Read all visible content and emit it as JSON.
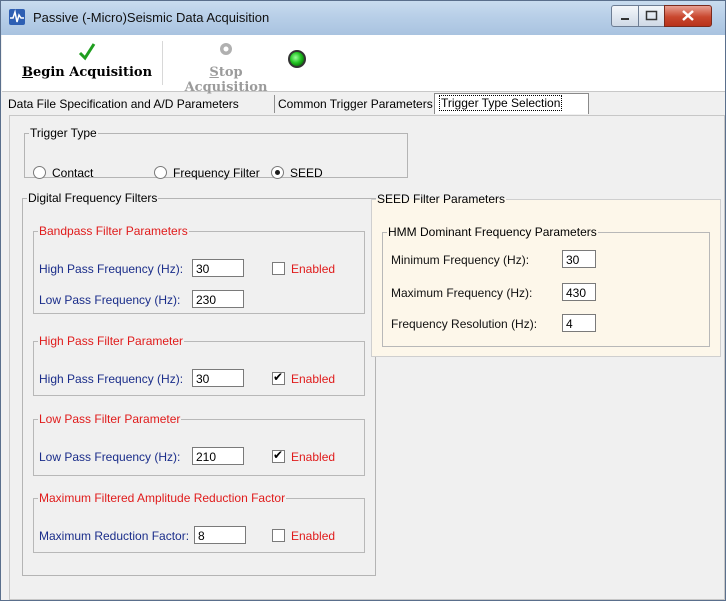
{
  "window": {
    "title": "Passive (-Micro)Seismic Data Acquisition",
    "controls": {
      "minimize": "minimize",
      "maximize": "maximize",
      "close": "close"
    }
  },
  "toolbar": {
    "begin_label": "Begin Acquisition",
    "stop_label": "Stop Acquisition",
    "begin_icon": "checkmark-icon",
    "stop_icon": "stop-gear-icon",
    "status_icon": "status-led-icon",
    "status_color": "#22c322"
  },
  "tabs": [
    {
      "label": "Data File Specification and A/D Parameters"
    },
    {
      "label": "Common Trigger Parameters"
    },
    {
      "label": "Trigger Type Selection",
      "selected": true
    }
  ],
  "trigger_type": {
    "legend": "Trigger Type",
    "options": [
      {
        "label": "Contact",
        "selected": false
      },
      {
        "label": "Frequency Filter",
        "selected": false
      },
      {
        "label": "SEED",
        "selected": true
      }
    ]
  },
  "digital_filters": {
    "legend": "Digital Frequency Filters",
    "bandpass": {
      "legend": "Bandpass Filter Parameters",
      "high_label": "High Pass  Frequency (Hz):",
      "high_value": "30",
      "low_label": "Low Pass Frequency (Hz):",
      "low_value": "230",
      "enabled_label": "Enabled",
      "enabled": false
    },
    "highpass": {
      "legend": "High Pass Filter Parameter",
      "label": "High Pass Frequency (Hz):",
      "value": "30",
      "enabled_label": "Enabled",
      "enabled": true
    },
    "lowpass": {
      "legend": "Low Pass Filter Parameter",
      "label": "Low Pass Frequency (Hz):",
      "value": "210",
      "enabled_label": "Enabled",
      "enabled": true
    },
    "max_reduction": {
      "legend": "Maximum Filtered Amplitude Reduction Factor",
      "label": "Maximum Reduction Factor:",
      "value": "8",
      "enabled_label": "Enabled",
      "enabled": false
    }
  },
  "seed": {
    "legend": "SEED Filter Parameters",
    "hmm_legend": "HMM Dominant Frequency Parameters",
    "min_label": "Minimum Frequency (Hz):",
    "min_value": "30",
    "max_label": "Maximum Frequency (Hz):",
    "max_value": "430",
    "res_label": "Frequency Resolution (Hz):",
    "res_value": "4"
  },
  "colors": {
    "accent_red": "#e01b1b",
    "label_blue": "#1a2d8a",
    "seed_bg": "#fdf7ea"
  }
}
